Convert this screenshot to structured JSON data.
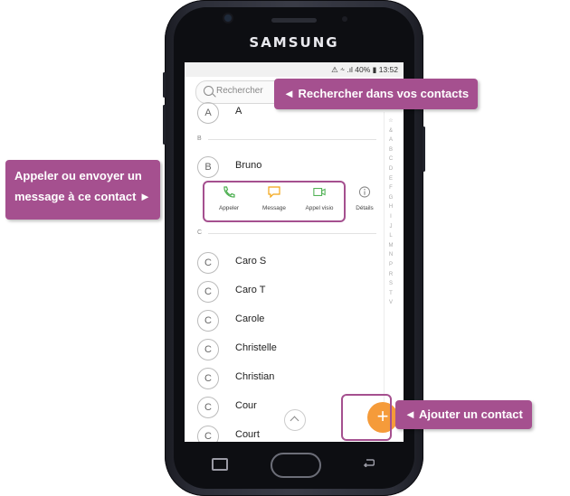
{
  "phone": {
    "brand": "SAMSUNG"
  },
  "status_bar": {
    "text": "⚠ ⸞ .ıl 40% ▮ 13:52"
  },
  "search": {
    "placeholder": "Rechercher"
  },
  "contacts": [
    {
      "initial": "A",
      "name": "A"
    },
    {
      "initial": "B",
      "name": "Bruno"
    },
    {
      "initial": "C",
      "name": "Caro S"
    },
    {
      "initial": "C",
      "name": "Caro T"
    },
    {
      "initial": "C",
      "name": "Carole"
    },
    {
      "initial": "C",
      "name": "Christelle"
    },
    {
      "initial": "C",
      "name": "Christian"
    },
    {
      "initial": "C",
      "name": "Cour"
    },
    {
      "initial": "C",
      "name": "Court"
    }
  ],
  "sections": [
    "B",
    "C"
  ],
  "actions": {
    "call": "Appeler",
    "message": "Message",
    "video": "Appel visio",
    "details": "Détails"
  },
  "alpha_index": [
    "☆",
    "&",
    "A",
    "B",
    "C",
    "D",
    "E",
    "F",
    "G",
    "H",
    "I",
    "J",
    "L",
    "M",
    "N",
    "P",
    "R",
    "S",
    "T",
    "V"
  ],
  "fab": {
    "label": "+"
  },
  "callouts": {
    "search": "◄ Rechercher dans vos contacts",
    "actions_line1": "Appeler ou envoyer un",
    "actions_line2": "message à ce contact ►",
    "add": "◄ Ajouter un contact"
  },
  "colors": {
    "accent": "#a5508f",
    "fab": "#f59b3a",
    "call": "#4caf50",
    "message": "#f2a515",
    "video": "#4caf50"
  }
}
